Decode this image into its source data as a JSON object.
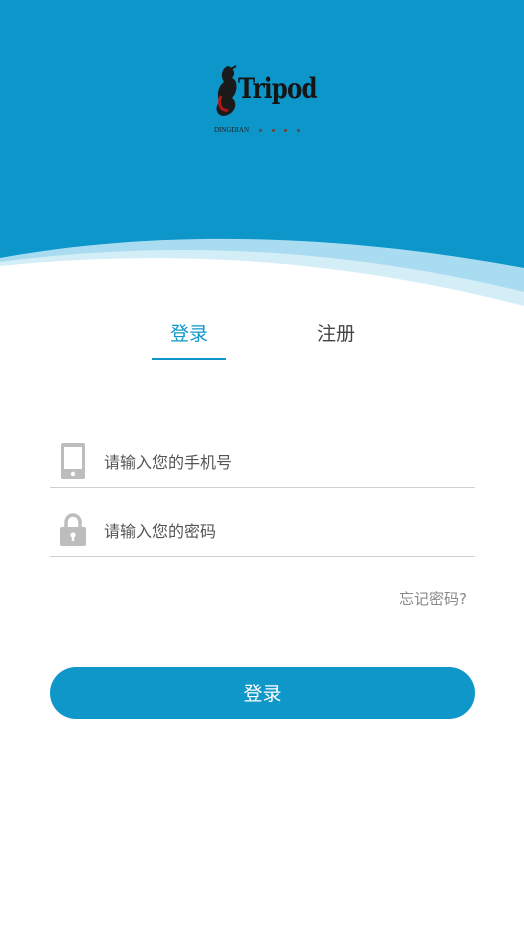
{
  "brand": {
    "logo_text": "Tripod",
    "logo_subtext": "DINGDIAN"
  },
  "tabs": {
    "login": "登录",
    "register": "注册",
    "active": "login"
  },
  "form": {
    "phone_placeholder": "请输入您的手机号",
    "password_placeholder": "请输入您的密码",
    "forgot_password": "忘记密码?"
  },
  "actions": {
    "login_button": "登录"
  },
  "colors": {
    "primary": "#1096c8",
    "header_bg": "#0c96c9"
  },
  "icons": {
    "phone": "phone-icon",
    "lock": "lock-icon"
  }
}
